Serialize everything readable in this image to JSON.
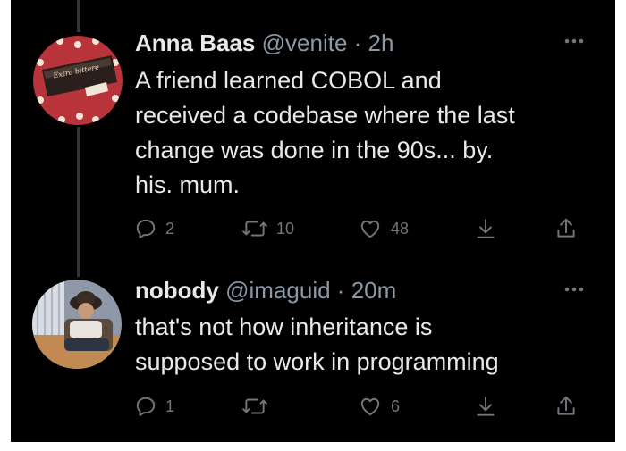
{
  "tweets": [
    {
      "name": "Anna Baas",
      "handle": "@venite",
      "separator": "·",
      "time": "2h",
      "text_lines": [
        "A friend learned COBOL and",
        "received a codebase where the last",
        "change was done in the 90s... by.",
        "his. mum."
      ],
      "avatar_text": "Extra bittere",
      "actions": {
        "reply_count": "2",
        "retweet_count": "10",
        "like_count": "48"
      }
    },
    {
      "name": "nobody",
      "handle": "@imaguid",
      "separator": "·",
      "time": "20m",
      "text_lines": [
        "that's not how inheritance is",
        "supposed to work in programming"
      ],
      "actions": {
        "reply_count": "1",
        "retweet_count": "",
        "like_count": "6"
      }
    }
  ],
  "colors": {
    "background": "#000000",
    "primary_text": "#e7e9ea",
    "secondary_text": "#8b98a5",
    "icon": "#71767b",
    "thread_line": "#333639"
  },
  "icons": [
    "more-icon",
    "reply-icon",
    "retweet-icon",
    "like-icon",
    "bookmark-icon",
    "share-icon"
  ]
}
